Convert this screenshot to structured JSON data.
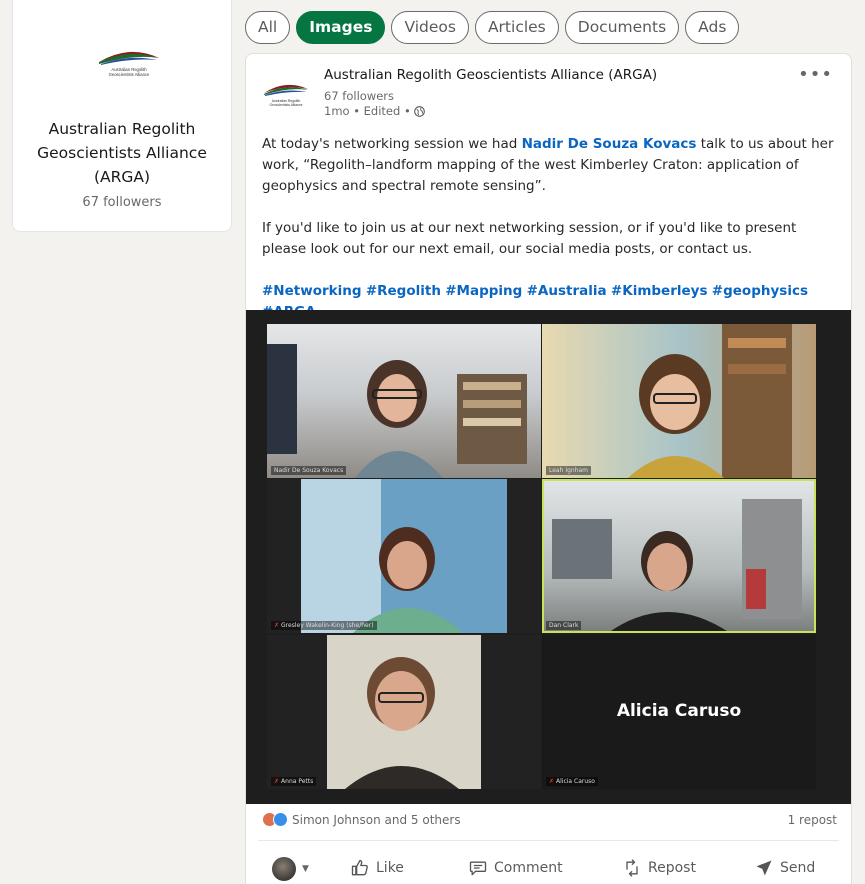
{
  "profile": {
    "org_name": "Australian Regolith Geoscientists Alliance (ARGA)",
    "followers": "67 followers",
    "logo_text": "Australian Regolith Geoscientists Alliance"
  },
  "filters": [
    {
      "label": "All",
      "active": false
    },
    {
      "label": "Images",
      "active": true
    },
    {
      "label": "Videos",
      "active": false
    },
    {
      "label": "Articles",
      "active": false
    },
    {
      "label": "Documents",
      "active": false
    },
    {
      "label": "Ads",
      "active": false
    }
  ],
  "post": {
    "author": "Australian Regolith Geoscientists Alliance (ARGA)",
    "followers": "67 followers",
    "meta": "1mo • Edited •",
    "more_icon": "•••",
    "text_before_mention": "At today's networking session we had ",
    "mention": "Nadir De Souza Kovacs",
    "text_after_mention": " talk to us about her work, “Regolith–landform mapping of the west Kimberley Craton: application of geophysics and spectral remote sensing”.",
    "paragraph2": "If you'd like to join us at our next networking session, or if you'd like to present please look out for our next email, our social media posts, or contact us.",
    "hashtags": [
      "#Networking",
      "#Regolith",
      "#Mapping",
      "#Australia",
      "#Kimberleys",
      "#geophysics",
      "#ARGA"
    ]
  },
  "meeting": {
    "participants": [
      {
        "name": "Nadir De Souza Kovacs",
        "muted": false,
        "active_speaker": false
      },
      {
        "name": "Leah Ignham",
        "muted": false,
        "active_speaker": false
      },
      {
        "name": "Gresley Wakelin-King (she/her)",
        "muted": true,
        "active_speaker": false
      },
      {
        "name": "Dan Clark",
        "muted": false,
        "active_speaker": true
      },
      {
        "name": "Anna Petts",
        "muted": true,
        "active_speaker": false
      },
      {
        "name": "Alicia Caruso",
        "muted": true,
        "active_speaker": false
      }
    ],
    "video_off_name": "Alicia Caruso"
  },
  "social": {
    "reactions_text": "Simon Johnson and 5 others",
    "reposts_text": "1 repost",
    "reaction_colors": {
      "love": "#df704d",
      "like": "#378fe9"
    }
  },
  "actions": {
    "like": "Like",
    "comment": "Comment",
    "repost": "Repost",
    "send": "Send"
  },
  "colors": {
    "brand_green": "#057642",
    "link_blue": "#0a66c2",
    "background": "#f3f2ef"
  }
}
